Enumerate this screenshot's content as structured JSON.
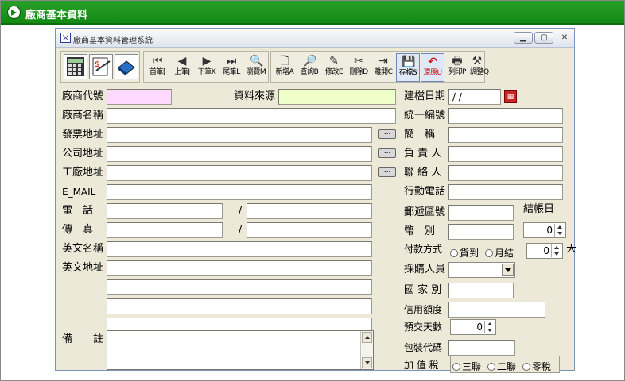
{
  "header": {
    "title": "廠商基本資料"
  },
  "window": {
    "title": "廠商基本資料管理系統"
  },
  "toolbar": {
    "buttons": [
      {
        "label": "首筆[",
        "icon": "first-record-icon"
      },
      {
        "label": "上筆J",
        "icon": "prev-record-icon"
      },
      {
        "label": "下筆K",
        "icon": "next-record-icon"
      },
      {
        "label": "尾筆L",
        "icon": "last-record-icon"
      },
      {
        "label": "瀏覽M",
        "icon": "browse-icon"
      },
      {
        "label": "新增A",
        "icon": "new-icon"
      },
      {
        "label": "查詢B",
        "icon": "query-icon"
      },
      {
        "label": "修改E",
        "icon": "edit-icon"
      },
      {
        "label": "刪除D",
        "icon": "delete-icon"
      },
      {
        "label": "離開C",
        "icon": "exit-icon"
      },
      {
        "label": "存檔S",
        "icon": "save-icon"
      },
      {
        "label": "還原U",
        "icon": "undo-icon"
      },
      {
        "label": "列印P",
        "icon": "print-icon"
      },
      {
        "label": "調整Q",
        "icon": "settings-icon"
      }
    ]
  },
  "form": {
    "vendor_code": "廠商代號",
    "data_source": "資料來源",
    "vendor_name": "廠商名稱",
    "invoice_address": "發票地址",
    "company_address": "公司地址",
    "factory_address": "工廠地址",
    "email": "E_MAIL",
    "phone": "電　話",
    "fax": "傳　真",
    "slash": "/",
    "english_name": "英文名稱",
    "english_address": "英文地址",
    "remarks": "備　　註",
    "created_date": "建檔日期",
    "created_date_value": " / /",
    "tax_id": "統一編號",
    "short_name": "簡　稱",
    "person_in_charge": "負 責 人",
    "contact": "聯 絡 人",
    "mobile": "行動電話",
    "zip": "郵遞區號",
    "closing_day": "結帳日",
    "currency": "幣　別",
    "currency_value": "0",
    "payment_method": "付款方式",
    "payment_cod": "貨到",
    "payment_monthly": "月結",
    "payment_days_value": "0",
    "payment_days_unit": "天",
    "purchaser": "採購人員",
    "country": "國 家 別",
    "credit_limit": "信用額度",
    "prepay_days": "預交天數",
    "prepay_days_value": "0",
    "package_code": "包裝代碼",
    "vat": "加 值 稅",
    "vat_triplicate": "三聯",
    "vat_duplicate": "二聯",
    "vat_zero": "零稅"
  },
  "colors": {
    "header_green": "#138a13",
    "pink_field": "#ffd9ff",
    "yellow_field": "#eeffc8"
  }
}
